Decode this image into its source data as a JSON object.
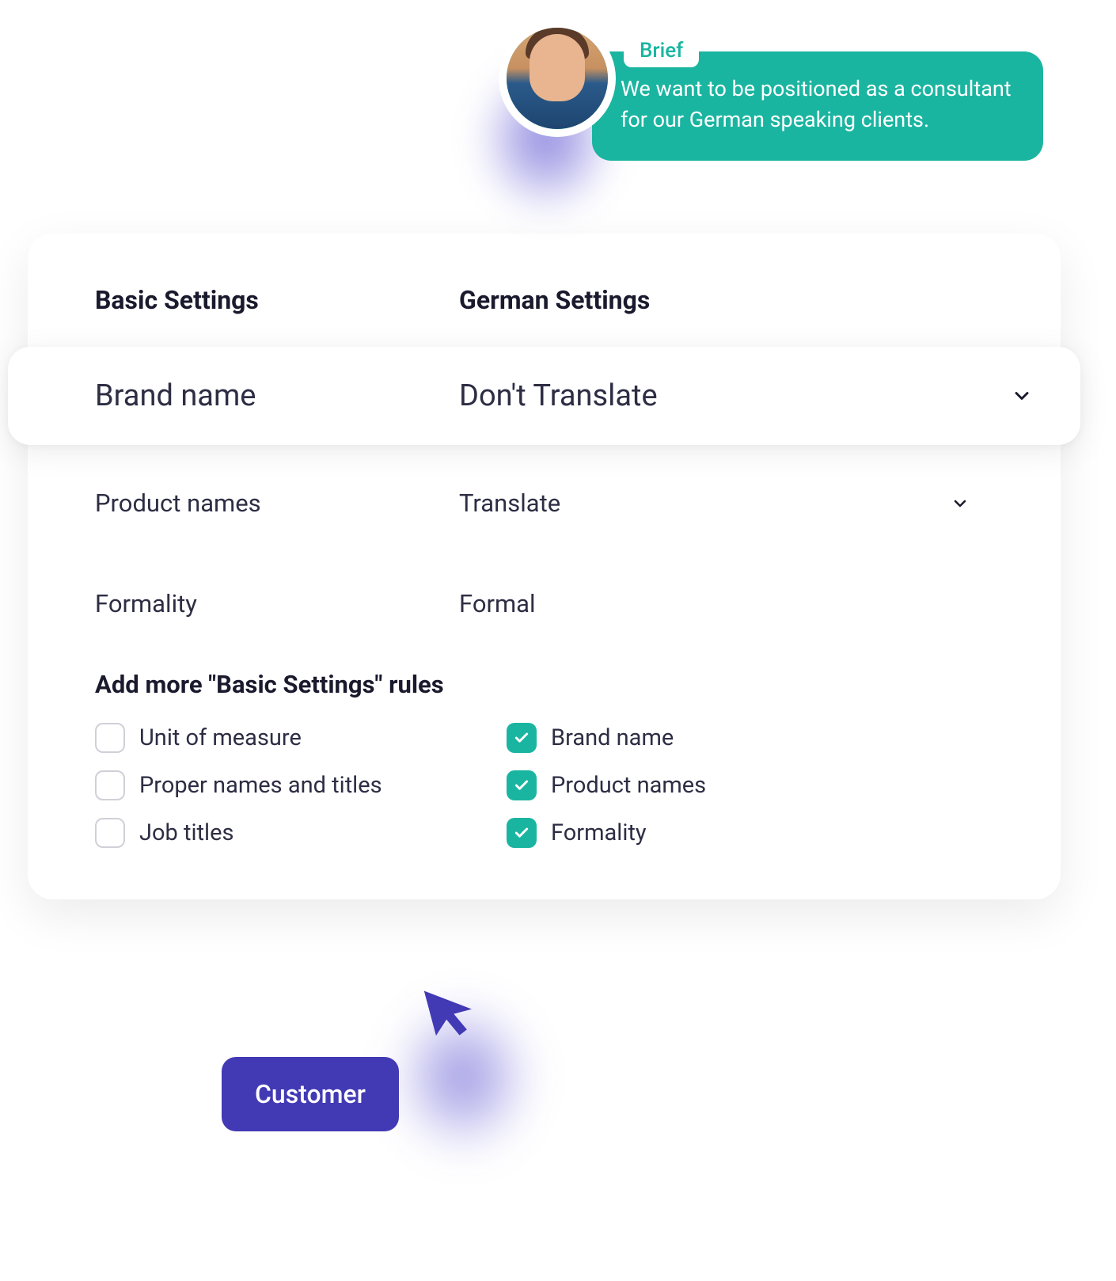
{
  "brief": {
    "label": "Brief",
    "text": "We want to be positioned as a consultant for our German speaking clients."
  },
  "headers": {
    "col1": "Basic Settings",
    "col2": "German Settings"
  },
  "highlighted": {
    "label": "Brand name",
    "value": "Don't Translate"
  },
  "rows": [
    {
      "label": "Product names",
      "value": "Translate",
      "has_chevron": true
    },
    {
      "label": "Formality",
      "value": "Formal",
      "has_chevron": false
    }
  ],
  "add_more": {
    "title": "Add more \"Basic Settings\" rules",
    "left": [
      {
        "label": "Unit of measure",
        "checked": false
      },
      {
        "label": "Proper names and titles",
        "checked": false
      },
      {
        "label": "Job titles",
        "checked": false
      }
    ],
    "right": [
      {
        "label": "Brand name",
        "checked": true
      },
      {
        "label": "Product names",
        "checked": true
      },
      {
        "label": "Formality",
        "checked": true
      }
    ]
  },
  "customer_label": "Customer"
}
